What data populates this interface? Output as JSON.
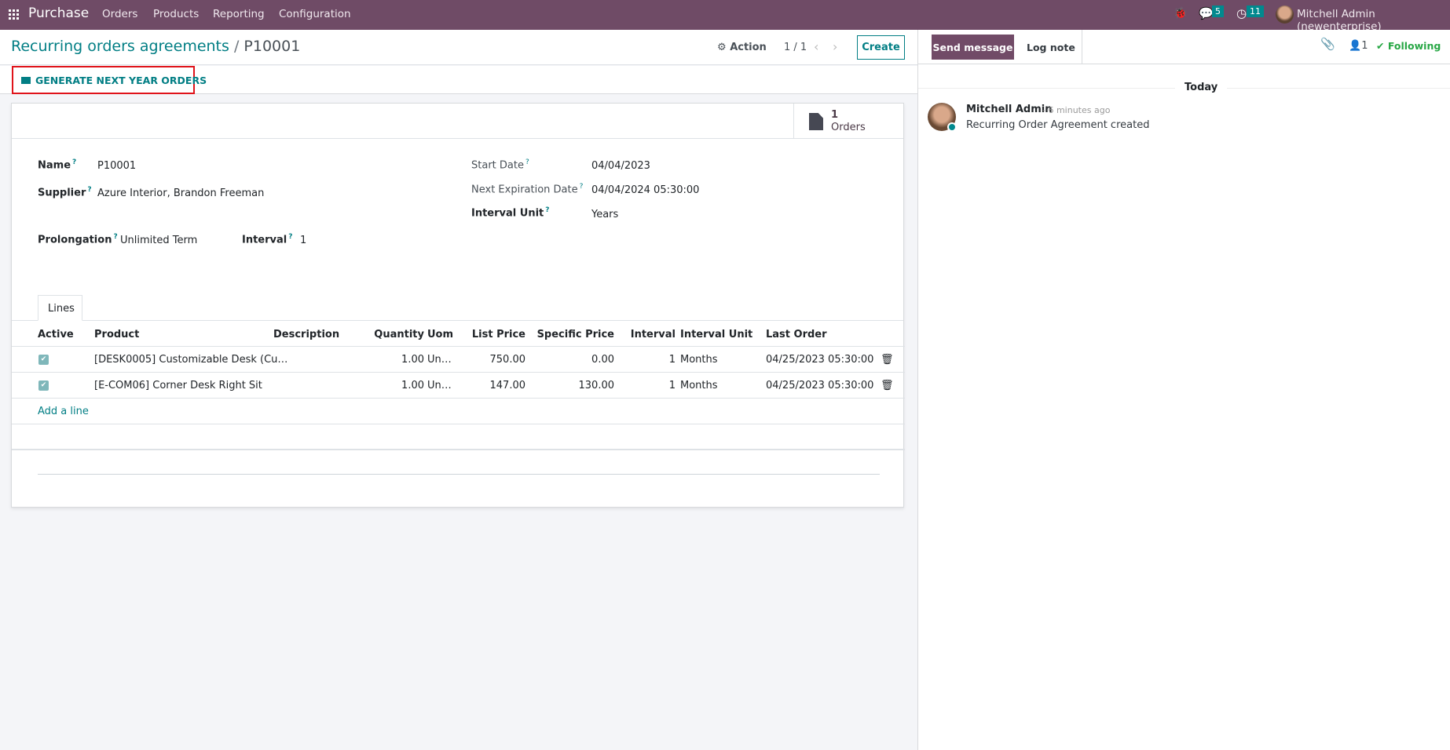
{
  "navbar": {
    "app_name": "Purchase",
    "menu": [
      "Orders",
      "Products",
      "Reporting",
      "Configuration"
    ],
    "messages_count": "5",
    "activities_count": "11",
    "user": "Mitchell Admin (newenterprise)"
  },
  "control_panel": {
    "breadcrumb_parent": "Recurring orders agreements",
    "breadcrumb_current": "P10001",
    "action_label": "Action",
    "pager": "1 / 1",
    "create_label": "Create"
  },
  "button_bar": {
    "generate_label": "GENERATE NEXT YEAR ORDERS"
  },
  "stat": {
    "count": "1",
    "label": "Orders"
  },
  "form": {
    "name_label": "Name",
    "name": "P10001",
    "supplier_label": "Supplier",
    "supplier": "Azure Interior, Brandon Freeman",
    "start_date_label": "Start Date",
    "start_date": "04/04/2023",
    "next_exp_label": "Next Expiration Date",
    "next_exp": "04/04/2024 05:30:00",
    "interval_unit_label": "Interval Unit",
    "interval_unit": "Years",
    "prolongation_label": "Prolongation",
    "prolongation": "Unlimited Term",
    "interval_label": "Interval",
    "interval": "1",
    "help_mark": "?"
  },
  "tabs": {
    "lines": "Lines"
  },
  "table": {
    "headers": {
      "active": "Active",
      "product": "Product",
      "description": "Description",
      "quantity": "Quantity",
      "uom": "Uom",
      "list_price": "List Price",
      "specific_price": "Specific Price",
      "interval": "Interval",
      "interval_unit": "Interval Unit",
      "last_order": "Last Order"
    },
    "rows": [
      {
        "product": "[DESK0005] Customizable Desk (Cu…",
        "description": "",
        "quantity": "1.00",
        "uom": "Un…",
        "list_price": "750.00",
        "specific_price": "0.00",
        "interval": "1",
        "interval_unit": "Months",
        "last_order": "04/25/2023 05:30:00"
      },
      {
        "product": "[E-COM06] Corner Desk Right Sit",
        "description": "",
        "quantity": "1.00",
        "uom": "Un…",
        "list_price": "147.00",
        "specific_price": "130.00",
        "interval": "1",
        "interval_unit": "Months",
        "last_order": "04/25/2023 05:30:00"
      }
    ],
    "add_line": "Add a line"
  },
  "chatter": {
    "send_message": "Send message",
    "log_note": "Log note",
    "followers_count": "1",
    "following": "Following",
    "date_separator": "Today",
    "messages": [
      {
        "author": "Mitchell Admin",
        "time": "- 6 minutes ago",
        "body": "Recurring Order Agreement created"
      }
    ]
  }
}
